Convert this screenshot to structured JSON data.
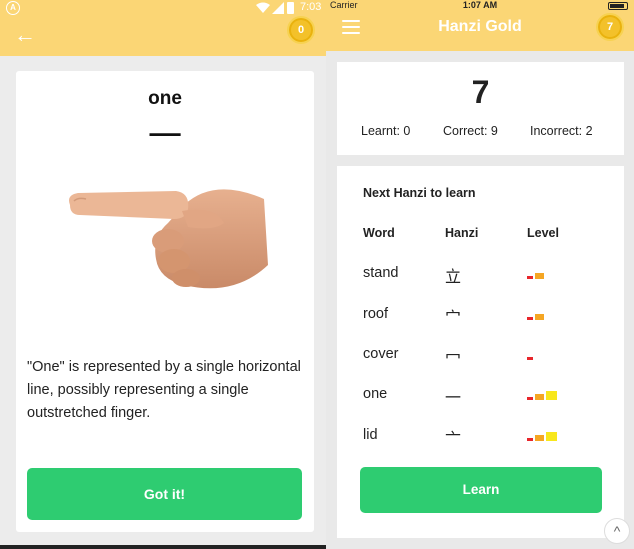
{
  "android": {
    "status_time": "7:03",
    "coins": "0",
    "back_glyph": "←",
    "card": {
      "word": "one",
      "hanzi": "一",
      "description": "\"One\" is represented by a single horizontal line, possibly representing a single outstretched finger.",
      "button": "Got it!"
    }
  },
  "ios": {
    "carrier": "Carrier",
    "status_time": "1:07 AM",
    "title": "Hanzi Gold",
    "coins": "7",
    "score": {
      "total": "7",
      "learnt": "Learnt: 0",
      "correct": "Correct: 9",
      "incorrect": "Incorrect: 2"
    },
    "list": {
      "heading": "Next Hanzi to learn",
      "columns": [
        "Word",
        "Hanzi",
        "Level"
      ],
      "rows": [
        {
          "word": "stand",
          "hanzi": "立",
          "level": 2
        },
        {
          "word": "roof",
          "hanzi": "宀",
          "level": 2
        },
        {
          "word": "cover",
          "hanzi": "冖",
          "level": 1
        },
        {
          "word": "one",
          "hanzi": "一",
          "level": 3
        },
        {
          "word": "lid",
          "hanzi": "亠",
          "level": 3
        }
      ],
      "button": "Learn"
    },
    "level_colors": [
      "#e8262b",
      "#f5a623",
      "#f8e71c"
    ]
  }
}
